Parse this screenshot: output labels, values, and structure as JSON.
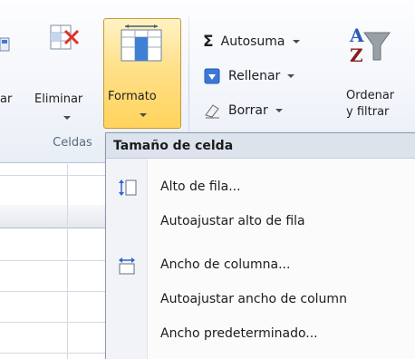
{
  "ribbon": {
    "insert_label": "ar",
    "eliminar_label": "Eliminar",
    "formato_label": "Formato",
    "group_label": "Celdas",
    "autosuma_label": "Autosuma",
    "rellenar_label": "Rellenar",
    "borrar_label": "Borrar",
    "ordenar_line1": "Ordenar",
    "ordenar_line2": "y filtrar",
    "sigma": "Σ"
  },
  "menu": {
    "header": "Tamaño de celda",
    "items": [
      {
        "label": "Alto de fila...",
        "icon": "row-height-icon"
      },
      {
        "label": "Autoajustar alto de fila",
        "icon": null
      },
      {
        "label": "Ancho de columna...",
        "icon": "column-width-icon"
      },
      {
        "label": "Autoajustar ancho de column",
        "icon": null
      },
      {
        "label": "Ancho predeterminado...",
        "icon": null
      }
    ]
  },
  "colors": {
    "formato_highlight": "#ffd35c",
    "menu_header_bg": "#dde3ec",
    "ribbon_bg": "#f3f6fb"
  }
}
